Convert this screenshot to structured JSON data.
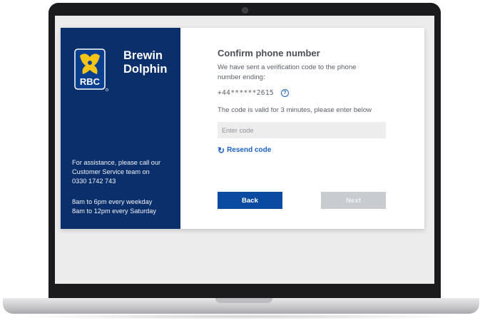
{
  "brand": {
    "logo_text": "RBC",
    "name_line1": "Brewin",
    "name_line2": "Dolphin"
  },
  "sidebar": {
    "assist_line1": "For assistance, please call our",
    "assist_line2": "Customer Service team on",
    "phone": "0330 1742 743",
    "hours_line1": "8am to 6pm every weekday",
    "hours_line2": "8am to 12pm every Saturday"
  },
  "form": {
    "title": "Confirm phone number",
    "description": "We have sent a verification code to the phone number ending:",
    "masked_number": "+44******2615",
    "help_icon": "question-circle-icon",
    "validity_text": "The code is valid for 3 minutes, please enter below",
    "code_placeholder": "Enter code",
    "code_value": "",
    "resend_label": "Resend code",
    "resend_icon": "refresh-icon"
  },
  "actions": {
    "back_label": "Back",
    "next_label": "Next"
  },
  "colors": {
    "sidebar_bg": "#0a2f6b",
    "primary": "#0a4aa1",
    "link": "#1b5fbf",
    "disabled": "#c8cbcf"
  }
}
